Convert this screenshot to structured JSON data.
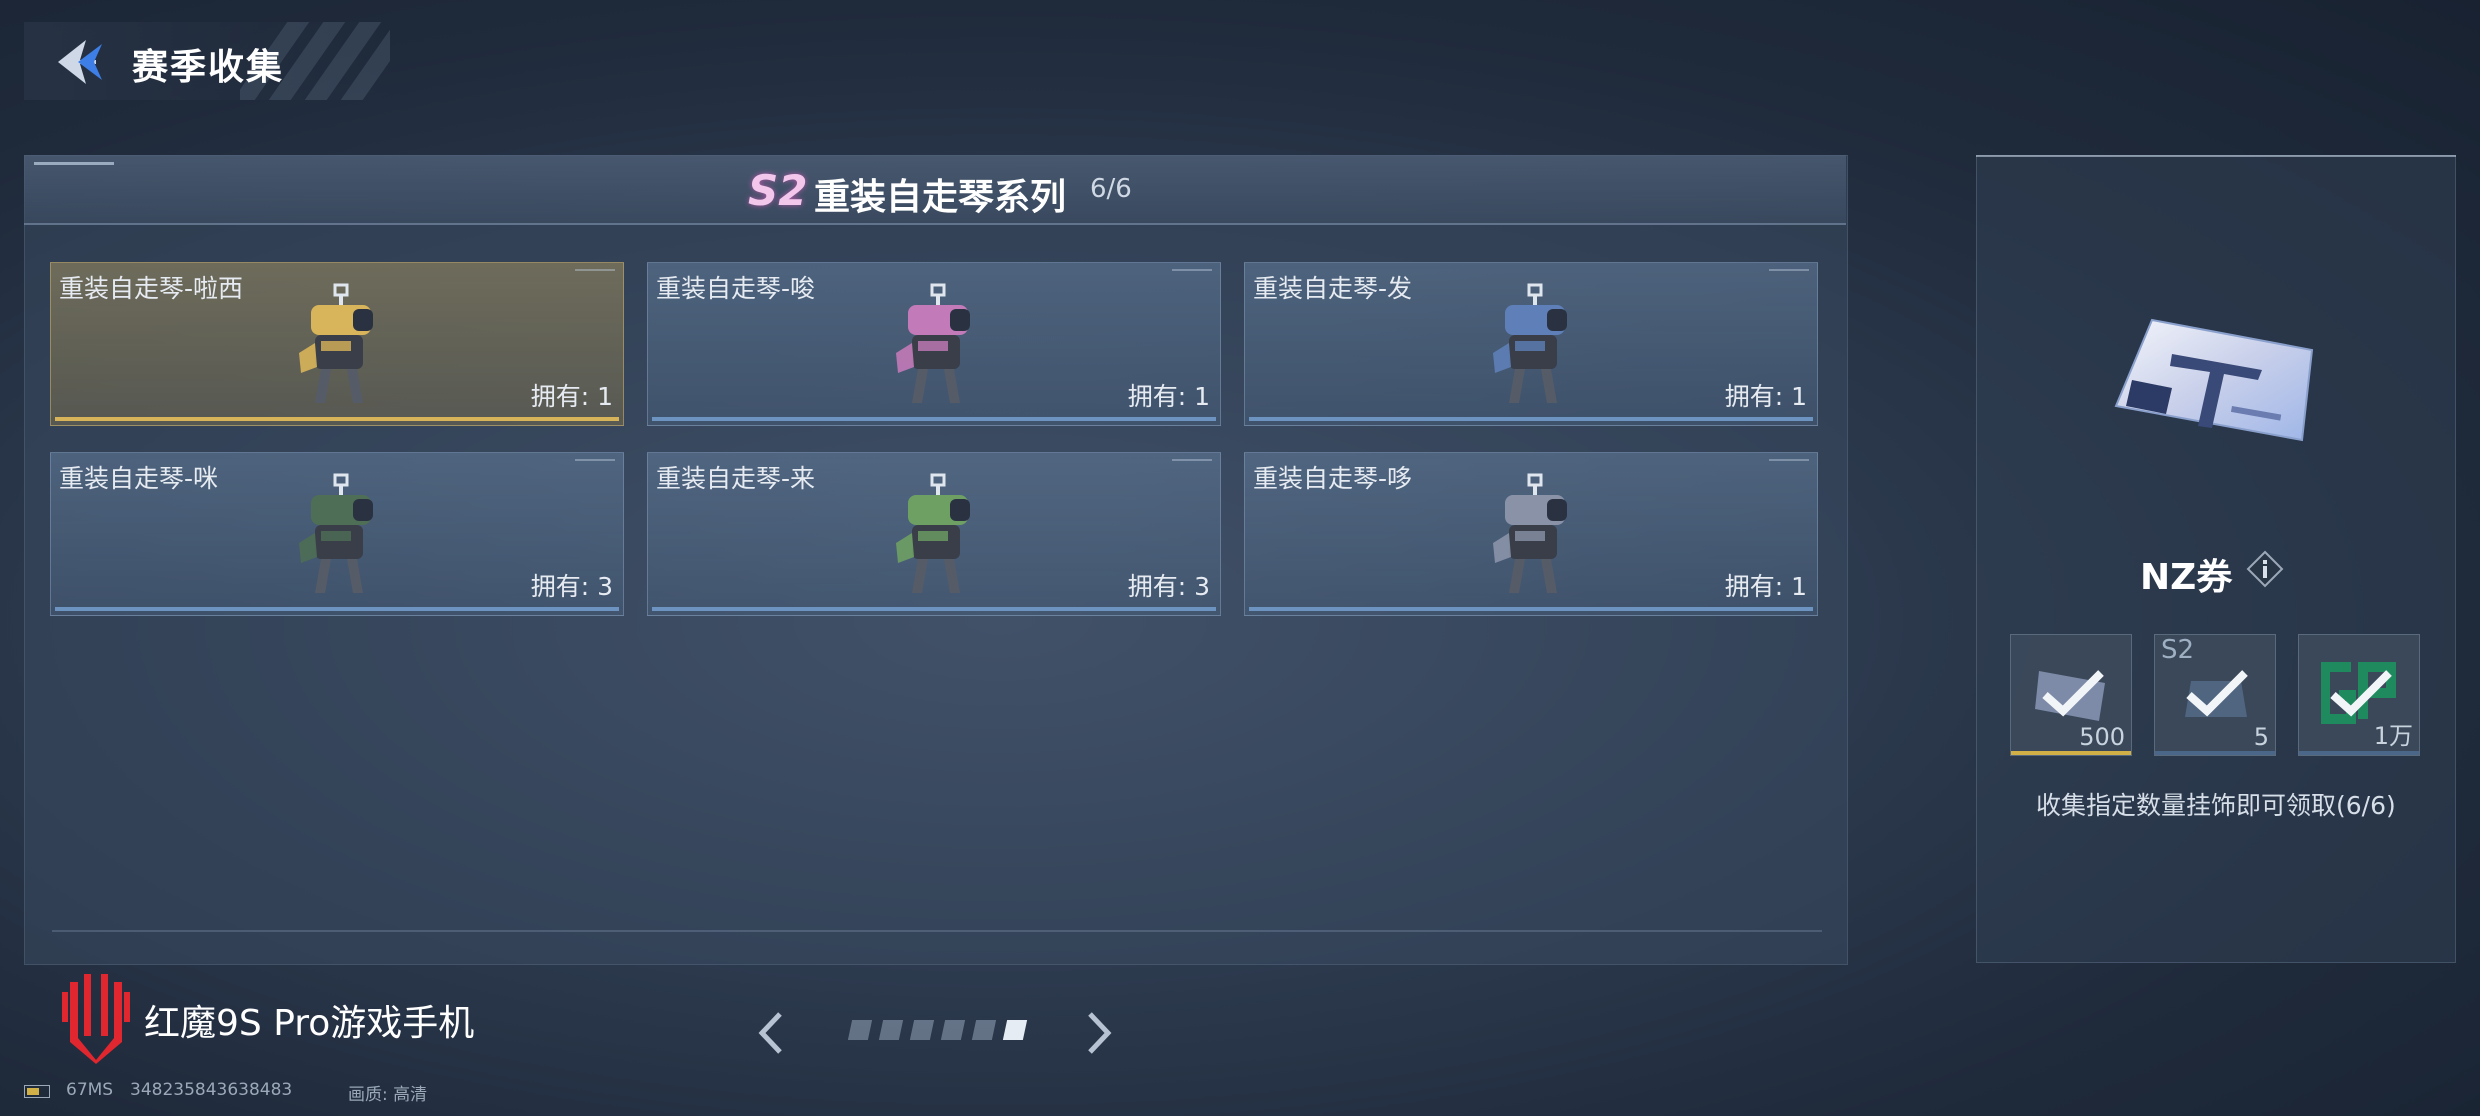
{
  "header": {
    "title": "赛季收集"
  },
  "series": {
    "badge": "S2",
    "title": "重装自走琴系列",
    "progress": "6/6"
  },
  "items": [
    {
      "name": "重装自走琴-啦西",
      "owned": "拥有: 1",
      "rarity": "gold",
      "color": "#d8b45a"
    },
    {
      "name": "重装自走琴-唆",
      "owned": "拥有: 1",
      "rarity": "normal",
      "color": "#c27ab8"
    },
    {
      "name": "重装自走琴-发",
      "owned": "拥有: 1",
      "rarity": "normal",
      "color": "#5e7fb8"
    },
    {
      "name": "重装自走琴-咪",
      "owned": "拥有: 3",
      "rarity": "normal",
      "color": "#4e6e55"
    },
    {
      "name": "重装自走琴-来",
      "owned": "拥有: 3",
      "rarity": "normal",
      "color": "#6ea064"
    },
    {
      "name": "重装自走琴-哆",
      "owned": "拥有: 1",
      "rarity": "normal",
      "color": "#8a92a8"
    }
  ],
  "reward": {
    "name": "NZ券",
    "slots": [
      {
        "qty": "500",
        "label": "",
        "icon": "nz-ticket-icon",
        "underline": "#d2b048"
      },
      {
        "qty": "5",
        "label": "S2",
        "icon": "s2-crate-icon",
        "underline": "#4a6688"
      },
      {
        "qty": "1万",
        "label": "",
        "icon": "gp-coin-icon",
        "underline": "#4a6688"
      }
    ],
    "claim_text": "收集指定数量挂饰即可领取(6/6)"
  },
  "pager": {
    "total": 6,
    "active": 6
  },
  "brand": {
    "text": "红魔9S Pro游戏手机"
  },
  "status": {
    "ping": "67MS",
    "id": "348235843638483",
    "quality": "画质:  高清"
  },
  "colors": {
    "accent_gold": "#d7b45a",
    "accent_blue": "#6d93c0",
    "badge_pink": "#f3c7ec",
    "brand_red": "#e0262e"
  }
}
